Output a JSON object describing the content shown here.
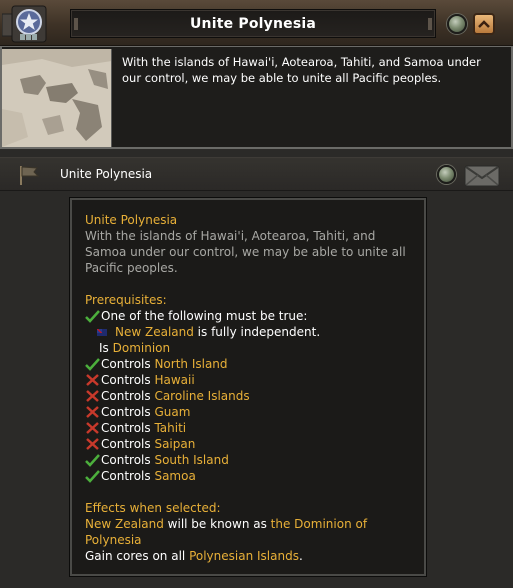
{
  "header": {
    "title": "Unite Polynesia",
    "emblem_icon": "star-emblem-icon",
    "collapse_icon": "chevron-up-icon"
  },
  "description": {
    "text": "With the islands of Hawai'i, Aotearoa, Tahiti, and Samoa under our control, we may be able to unite all Pacific peoples."
  },
  "focus_row": {
    "label": "Unite Polynesia",
    "flag_icon": "flag-icon",
    "envelope_icon": "envelope-icon"
  },
  "tooltip": {
    "title": "Unite Polynesia",
    "description": "With the islands of Hawai'i, Aotearoa, Tahiti, and Samoa under our control, we may be able to unite all Pacific peoples.",
    "prerequisites_header": "Prerequisites:",
    "one_of": "One of the following must be true:",
    "nz_country": "New Zealand",
    "nz_suffix": " is fully independent.",
    "is_prefix": "Is ",
    "is_value": "Dominion",
    "controls_prefix": "Controls ",
    "controls": [
      {
        "place": "North Island",
        "met": true
      },
      {
        "place": "Hawaii",
        "met": false
      },
      {
        "place": "Caroline Islands",
        "met": false
      },
      {
        "place": "Guam",
        "met": false
      },
      {
        "place": "Tahiti",
        "met": false
      },
      {
        "place": "Saipan",
        "met": false
      },
      {
        "place": "South Island",
        "met": true
      },
      {
        "place": "Samoa",
        "met": true
      }
    ],
    "effects_header": "Effects when selected:",
    "effect1_country": "New Zealand",
    "effect1_mid": " will be known as ",
    "effect1_name": "the Dominion of Polynesia",
    "effect2_prefix": "Gain cores on all ",
    "effect2_value": "Polynesian Islands",
    "effect2_suffix": "."
  },
  "colors": {
    "gold": "#e8b038",
    "check_green": "#4caf3c",
    "cross_red": "#c8392b"
  }
}
